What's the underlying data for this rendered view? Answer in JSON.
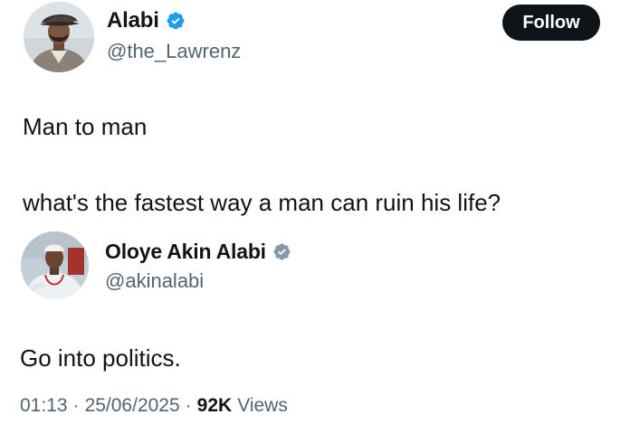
{
  "tweet": {
    "author_name": "Alabi",
    "author_handle": "@the_Lawrenz",
    "verified_badge_icon": "verified-badge-icon",
    "verified_color": "#1d9bf0",
    "follow_label": "Follow",
    "lines": [
      "Man to man",
      "what's the fastest way a man can ruin his life?"
    ]
  },
  "reply": {
    "author_name": "Oloye Akin Alabi",
    "author_handle": "@akinalabi",
    "verified_badge_icon": "verified-badge-grey-icon",
    "verified_color": "#829aab",
    "text": "Go into politics.",
    "time": "01:13",
    "date": "25/06/2025",
    "views_count": "92K",
    "views_label": "Views"
  }
}
